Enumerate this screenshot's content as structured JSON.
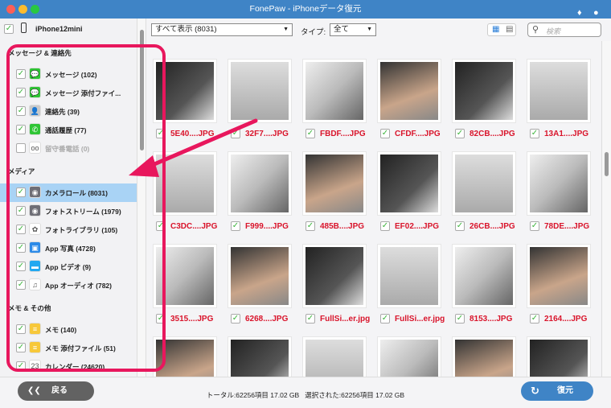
{
  "window": {
    "title": "FonePaw - iPhoneデータ復元"
  },
  "icons": {
    "diamond": "diamond-icon",
    "chat": "chat-bubble-icon"
  },
  "device": {
    "name": "iPhone12mini",
    "checked": true
  },
  "sidebar": {
    "sections": [
      {
        "title": "メッセージ & 連絡先",
        "items": [
          {
            "label": "メッセージ (102)",
            "icon": "messages-icon",
            "color": "#2fc535",
            "checked": true
          },
          {
            "label": "メッセージ 添付ファイ...",
            "icon": "messages-icon",
            "color": "#2fc535",
            "checked": true
          },
          {
            "label": "連絡先 (39)",
            "icon": "contacts-icon",
            "color": "#c9c9c9",
            "checked": true
          },
          {
            "label": "通話履歴 (77)",
            "icon": "phone-icon",
            "color": "#2fc535",
            "checked": true
          },
          {
            "label": "留守番電話 (0)",
            "icon": "voicemail-icon",
            "color": "#ffffff",
            "checked": false,
            "disabled": true
          }
        ]
      },
      {
        "title": "メディア",
        "items": [
          {
            "label": "カメラロール (8031)",
            "icon": "camera-icon",
            "color": "#6e6e76",
            "checked": true,
            "selected": true
          },
          {
            "label": "フォトストリーム (1979)",
            "icon": "camera-icon",
            "color": "#6e6e76",
            "checked": true
          },
          {
            "label": "フォトライブラリ (105)",
            "icon": "photos-icon",
            "color": "#ffffff",
            "checked": true
          },
          {
            "label": "App 写真 (4728)",
            "icon": "app-photo-icon",
            "color": "#2c8ae8",
            "checked": true
          },
          {
            "label": "App ビデオ (9)",
            "icon": "clapper-icon",
            "color": "#22a8f0",
            "checked": true
          },
          {
            "label": "App オーディオ (782)",
            "icon": "music-note-icon",
            "color": "#ffffff",
            "checked": true
          }
        ]
      },
      {
        "title": "メモ & その他",
        "items": [
          {
            "label": "メモ (140)",
            "icon": "notes-icon",
            "color": "#f7c83a",
            "checked": true
          },
          {
            "label": "メモ 添付ファイル (51)",
            "icon": "notes-icon",
            "color": "#f7c83a",
            "checked": true
          },
          {
            "label": "カレンダー (24620)",
            "icon": "calendar-icon",
            "color": "#ffffff",
            "checked": true
          }
        ]
      }
    ]
  },
  "toolbar": {
    "filter_value": "すべて表示 (8031)",
    "type_label": "タイプ:",
    "type_value": "全て",
    "search_placeholder": "検索",
    "view_mode": "grid"
  },
  "files": [
    "5E40....JPG",
    "32F7....JPG",
    "FBDF....JPG",
    "CFDF....JPG",
    "82CB....JPG",
    "13A1....JPG",
    "C3DC....JPG",
    "F999....JPG",
    "485B....JPG",
    "EF02....JPG",
    "26CB....JPG",
    "78DE....JPG",
    "3515....JPG",
    "6268....JPG",
    "FullSi...er.jpg",
    "FullSi...er.jpg",
    "8153....JPG",
    "2164....JPG"
  ],
  "footer": {
    "back_label": "戻る",
    "status": "トータル:62256項目 17.02 GB   選択された:62256項目 17.02 GB",
    "restore_label": "復元"
  },
  "colors": {
    "titlebar": "#3f84c6",
    "accent": "#3f84c6",
    "filename": "#d9142b",
    "annotation": "#e8175d",
    "selected_row": "#a9d3f5"
  }
}
